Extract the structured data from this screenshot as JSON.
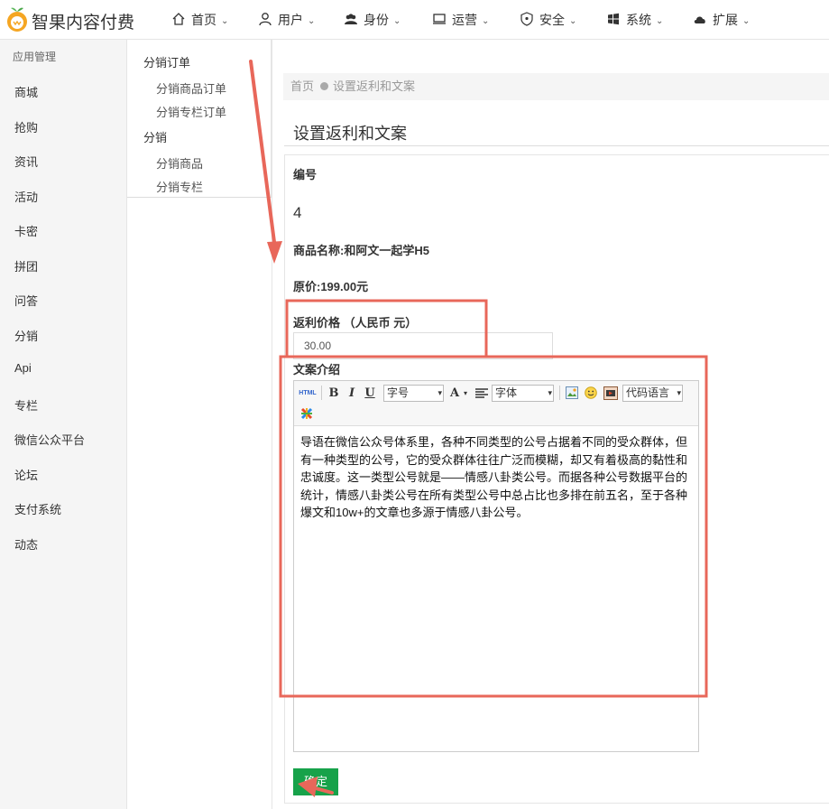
{
  "app": {
    "title": "智果内容付费"
  },
  "colors": {
    "accent_green": "#17a24a",
    "annotation_red": "#e8675a",
    "logo_orange": "#f5a623"
  },
  "topnav": [
    {
      "label": "首页",
      "icon": "home-icon"
    },
    {
      "label": "用户",
      "icon": "user-icon"
    },
    {
      "label": "身份",
      "icon": "users-icon"
    },
    {
      "label": "运营",
      "icon": "monitor-icon"
    },
    {
      "label": "安全",
      "icon": "shield-icon"
    },
    {
      "label": "系统",
      "icon": "windows-icon"
    },
    {
      "label": "扩展",
      "icon": "cloud-icon"
    }
  ],
  "sidebar": {
    "heading": "应用管理",
    "items": [
      "商城",
      "抢购",
      "资讯",
      "活动",
      "卡密",
      "拼团",
      "问答",
      "分销",
      "Api",
      "专栏",
      "微信公众平台",
      "论坛",
      "支付系统",
      "动态"
    ]
  },
  "submenu": {
    "groups": [
      {
        "label": "分销订单",
        "items": [
          "分销商品订单",
          "分销专栏订单"
        ]
      },
      {
        "label": "分销",
        "items": [
          "分销商品",
          "分销专栏"
        ]
      }
    ]
  },
  "breadcrumb": {
    "home": "首页",
    "current": "设置返利和文案"
  },
  "page": {
    "title": "设置返利和文案"
  },
  "form": {
    "id_label": "编号",
    "id_value": "4",
    "product_name": "商品名称:和阿文一起学H5",
    "original_price": "原价:199.00元",
    "rebate_label": "返利价格 （人民币 元）",
    "rebate_value": "30.00",
    "copy_label": "文案介绍",
    "submit_label": "确定"
  },
  "editor": {
    "html_btn": "HTML",
    "bold": "B",
    "italic": "I",
    "underline": "U",
    "font_size_select": "字号",
    "font_color": "A",
    "font_family_select": "字体",
    "code_lang_select": "代码语言",
    "content": "导语在微信公众号体系里，各种不同类型的公号占据着不同的受众群体，但有一种类型的公号，它的受众群体往往广泛而模糊，却又有着极高的黏性和忠诚度。这一类型公号就是——情感八卦类公号。而据各种公号数据平台的统计，情感八卦类公号在所有类型公号中总占比也多排在前五名，至于各种爆文和10w+的文章也多源于情感八卦公号。"
  }
}
